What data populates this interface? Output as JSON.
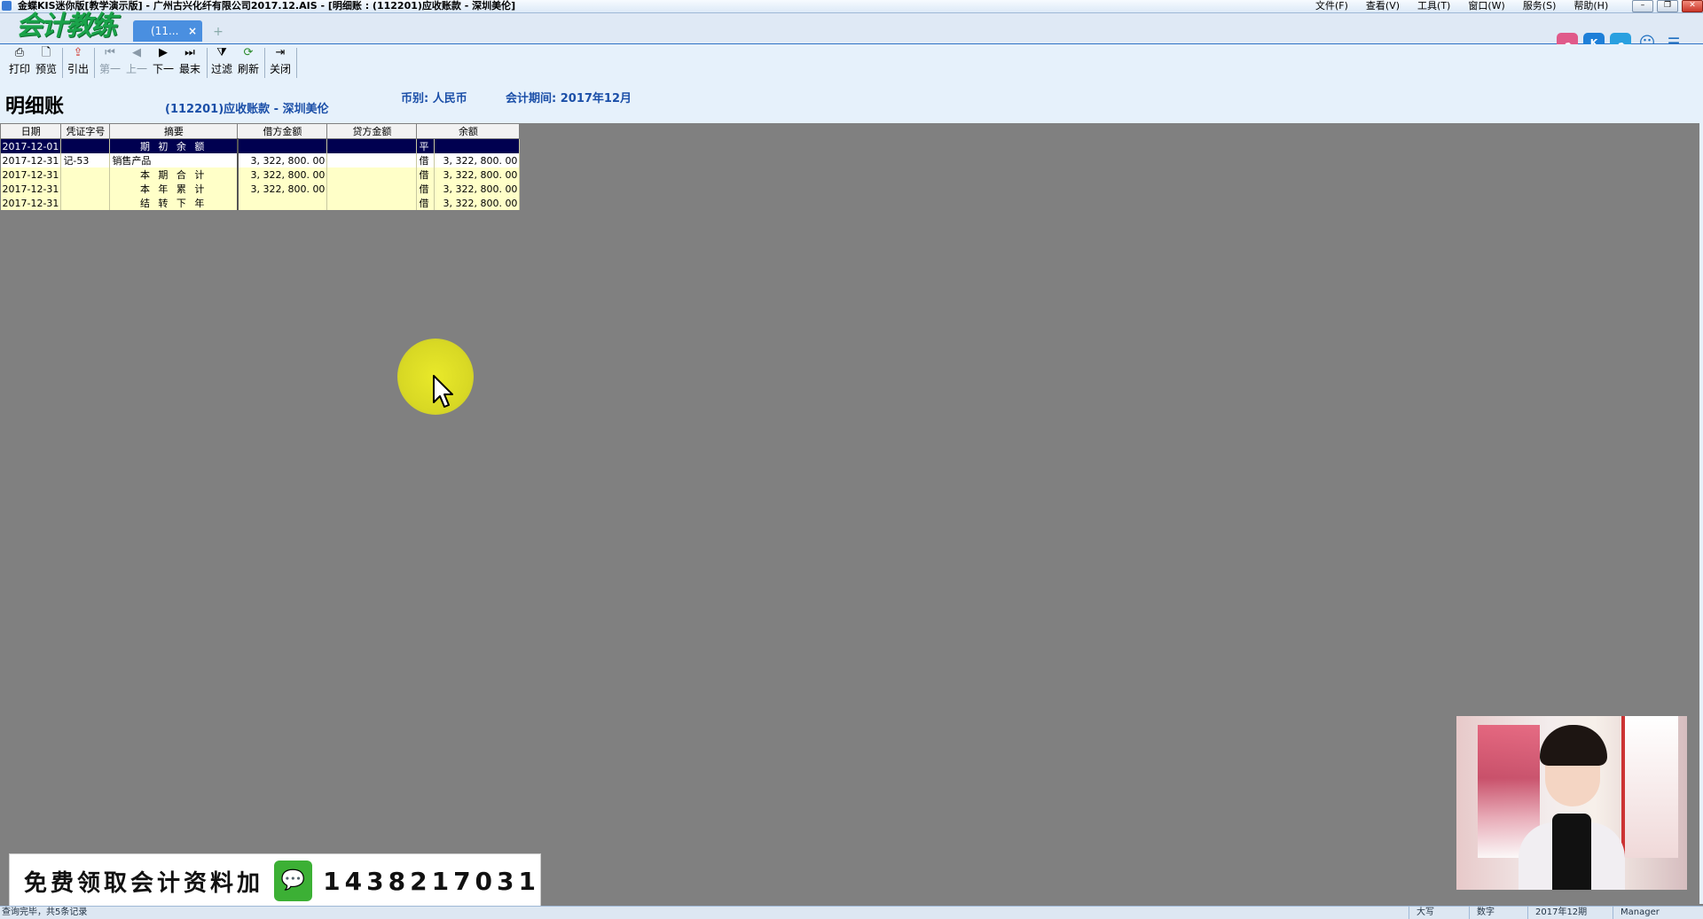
{
  "window": {
    "title": "金蝶KIS迷你版[教学演示版] - 广州古兴化纤有限公司2017.12.AIS - [明细账 : (112201)应收账款 - 深圳美伦]",
    "menu": [
      "文件(F)",
      "查看(V)",
      "工具(T)",
      "窗口(W)",
      "服务(S)",
      "帮助(H)"
    ]
  },
  "tabs": {
    "logo_text": "会计教练",
    "active_tab": "(11...",
    "close_symbol": "×",
    "add_symbol": "+"
  },
  "tray_icons": [
    "cloud-icon",
    "kis-icon",
    "cloud-sync-icon",
    "smile-icon",
    "message-icon"
  ],
  "toolbar": {
    "print": "打印",
    "preview": "预览",
    "export": "引出",
    "first": "第一",
    "prev": "上一",
    "next": "下一",
    "last": "最末",
    "filter": "过滤",
    "refresh": "刷新",
    "close": "关闭"
  },
  "report": {
    "title": "明细账",
    "account": "(112201)应收账款 - 深圳美伦",
    "currency": "币别: 人民币",
    "period": "会计期间: 2017年12月"
  },
  "ledger": {
    "columns": [
      "日期",
      "凭证字号",
      "摘要",
      "借方金额",
      "贷方金额",
      "余额"
    ],
    "rows": [
      {
        "date": "2017-12-01",
        "voucher": "",
        "summary": "期 初 余 额",
        "debit": "",
        "credit": "",
        "direction": "平",
        "balance": ""
      },
      {
        "date": "2017-12-31",
        "voucher": "记-53",
        "summary": "销售产品",
        "debit": "3, 322, 800. 00",
        "credit": "",
        "direction": "借",
        "balance": "3, 322, 800. 00"
      },
      {
        "date": "2017-12-31",
        "voucher": "",
        "summary": "本 期 合 计",
        "debit": "3, 322, 800. 00",
        "credit": "",
        "direction": "借",
        "balance": "3, 322, 800. 00"
      },
      {
        "date": "2017-12-31",
        "voucher": "",
        "summary": "本 年 累 计",
        "debit": "3, 322, 800. 00",
        "credit": "",
        "direction": "借",
        "balance": "3, 322, 800. 00"
      },
      {
        "date": "2017-12-31",
        "voucher": "",
        "summary": "结 转 下 年",
        "debit": "",
        "credit": "",
        "direction": "借",
        "balance": "3, 322, 800. 00"
      }
    ]
  },
  "promo": {
    "text": "免费领取会计资料加",
    "number": "1438217031"
  },
  "statusbar": {
    "message": "查询完毕，共5条记录",
    "caps": "大写",
    "num": "数字",
    "period": "2017年12期",
    "user": "Manager"
  },
  "colors": {
    "selected_row": "#000050",
    "row_highlight": "#ffffc8",
    "accent_blue": "#1b4fa8",
    "workspace": "#808080"
  }
}
